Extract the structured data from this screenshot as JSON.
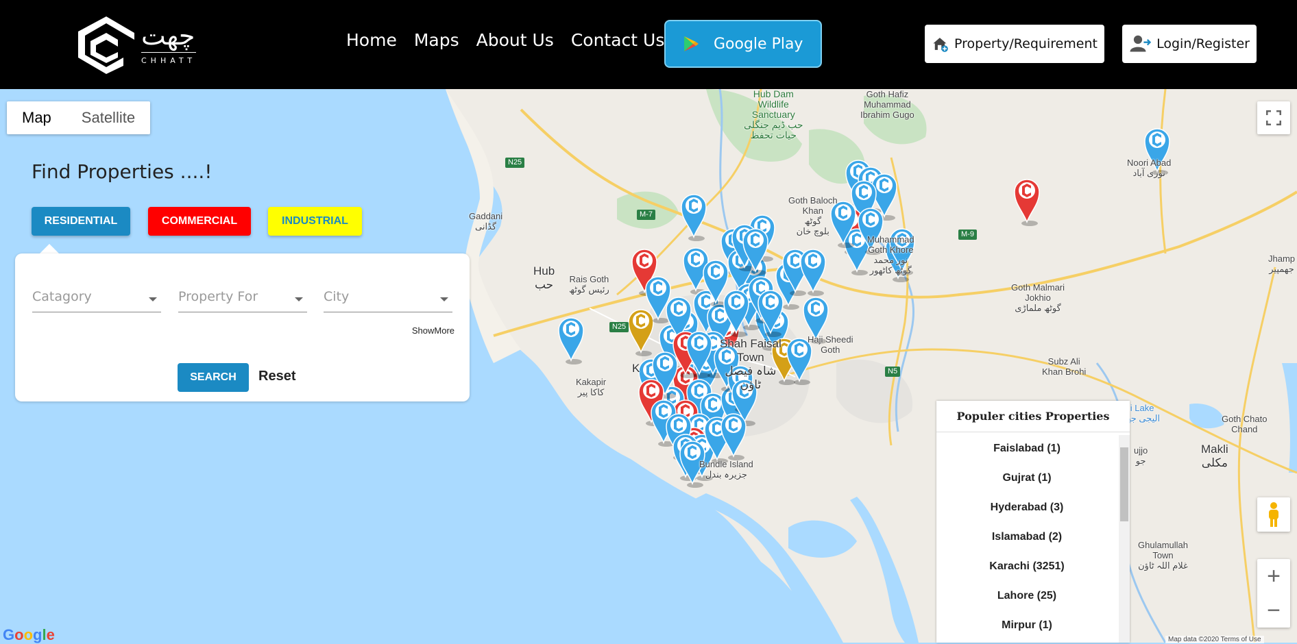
{
  "header": {
    "logo_urdu": "چھت",
    "logo_sub": "CHHATT",
    "nav": [
      "Home",
      "Maps",
      "About Us",
      "Contact Us"
    ],
    "google_play": "Google Play",
    "property_btn": "Property/Requirement",
    "login_btn": "Login/Register"
  },
  "map_type": {
    "map": "Map",
    "satellite": "Satellite"
  },
  "filter": {
    "title": "Find Properties ....!",
    "types": [
      {
        "label": "RESIDENTIAL",
        "bg": "#1b8ac3",
        "fg": "#ffffff"
      },
      {
        "label": "COMMERCIAL",
        "bg": "#ff0000",
        "fg": "#ffffff"
      },
      {
        "label": "INDUSTRIAL",
        "bg": "#ffff00",
        "fg": "#1b8ac3"
      }
    ],
    "category_placeholder": "Catagory",
    "property_for_placeholder": "Property For",
    "city_placeholder": "City",
    "show_more": "ShowMore",
    "search": "SEARCH",
    "reset": "Reset"
  },
  "cities_panel": {
    "title": "Populer cities Properties",
    "items": [
      "Faislabad (1)",
      "Gujrat (1)",
      "Hyderabad (3)",
      "Islamabad (2)",
      "Karachi (3251)",
      "Lahore (25)",
      "Mirpur (1)"
    ]
  },
  "map_labels": {
    "hub_dam": "Hub Dam\nWildlife\nSanctuary\nحب ڈیم جنگلی\nحیات تحفظ",
    "gadani": "Gaddani\nگڈانی",
    "hub": "Hub\nحب",
    "rais_goth": "Rais Goth\nرئیس گوٹھ",
    "goth_baloch": "Goth Baloch\nKhan\nگوٹھ\nبلوچ خان",
    "muhammad": "Muhammad\nGoth Khore\nنور محمد\nگوٹھ کاٹھور",
    "goth_hafiz": "Goth Hafiz\nMuhammad\nIbrahim Gugo",
    "noori_abad": "Noori Abad\nنوری آباد",
    "jhampir": "Jhamp\nجھمپیر",
    "malmari": "Goth Malmari\nJokhio\nگوٹھ ملماڑی",
    "shah_faisal": "Shah Faisal\nTown\nشاہ فیصل\nٹاؤن",
    "haji_sheedi": "Haji Sheedi\nGoth",
    "kakapir": "Kakapir\nکاکا پیر",
    "subz_ali": "Subz Ali\nKhan Brohi",
    "goth_chato": "Goth Chato\nChand",
    "makli": "Makli\nمکلی",
    "bundle": "Bundle Island\nجزیرہ بندل",
    "ghulamullah": "Ghulamullah\nTown\nغلام اللہ ٹاؤن",
    "haji_lake": "eji Lake\nالیجی جھیل",
    "jujjo": "ujjo\nجو",
    "karachi": "K"
  },
  "roads": {
    "n25a": "N25",
    "n25b": "N25",
    "m7": "M-7",
    "m9": "M-9",
    "n5": "N5"
  },
  "google": "Google",
  "attribution": "Map data ©2020   Terms of Use",
  "colors": {
    "marker_blue": "#3aa6e8",
    "marker_red": "#e53935",
    "marker_gold": "#d4a017",
    "water": "#aadaff",
    "land": "#efece6"
  }
}
